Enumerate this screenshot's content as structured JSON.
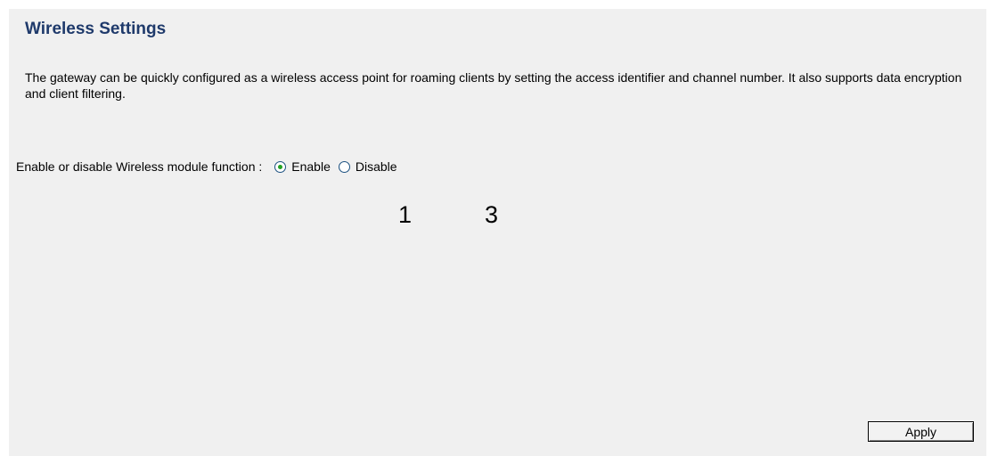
{
  "page": {
    "title": "Wireless Settings",
    "description": "The gateway can be quickly configured as a wireless access point for roaming clients by setting the access identifier and channel number. It also supports data encryption and client filtering."
  },
  "wireless_module": {
    "label": "Enable or disable Wireless module function :",
    "options": [
      {
        "label": "Enable",
        "selected": true
      },
      {
        "label": "Disable",
        "selected": false
      }
    ]
  },
  "callouts": [
    "1",
    "3"
  ],
  "buttons": {
    "apply": "Apply"
  },
  "colors": {
    "title": "#1f3a6b",
    "panel_background": "#f0f0f0",
    "radio_selected_dot": "#21a121"
  }
}
